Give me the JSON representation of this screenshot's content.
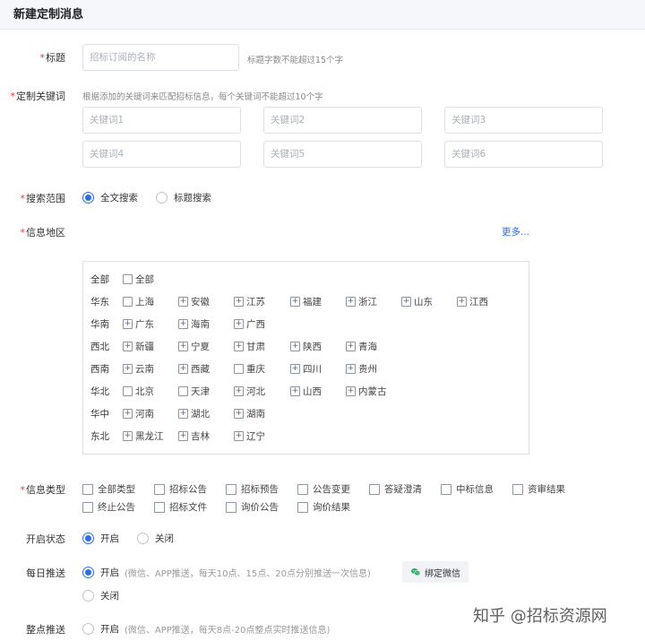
{
  "header": {
    "title": "新建定制消息"
  },
  "title_field": {
    "label": "标题",
    "placeholder": "招标订阅的名称",
    "hint": "标题字数不能超过15个字"
  },
  "keywords": {
    "label": "定制关键词",
    "hint": "根据添加的关键词来匹配招标信息，每个关键词不能超过10个字",
    "placeholders": [
      "关键词1",
      "关键词2",
      "关键词3",
      "关键词4",
      "关键词5",
      "关键词6"
    ]
  },
  "search_scope": {
    "label": "搜索范围",
    "options": [
      "全文搜索",
      "标题搜索"
    ],
    "selected": "全文搜索"
  },
  "region": {
    "label": "信息地区",
    "more": "更多...",
    "groups": [
      {
        "name": "全部",
        "items": [
          {
            "name": "全部",
            "expandable": false
          }
        ]
      },
      {
        "name": "华东",
        "items": [
          {
            "name": "上海",
            "expandable": false
          },
          {
            "name": "安徽",
            "expandable": true
          },
          {
            "name": "江苏",
            "expandable": true
          },
          {
            "name": "福建",
            "expandable": true
          },
          {
            "name": "浙江",
            "expandable": true
          },
          {
            "name": "山东",
            "expandable": true
          },
          {
            "name": "江西",
            "expandable": true
          }
        ]
      },
      {
        "name": "华南",
        "items": [
          {
            "name": "广东",
            "expandable": true
          },
          {
            "name": "海南",
            "expandable": true
          },
          {
            "name": "广西",
            "expandable": true
          }
        ]
      },
      {
        "name": "西北",
        "items": [
          {
            "name": "新疆",
            "expandable": true
          },
          {
            "name": "宁夏",
            "expandable": true
          },
          {
            "name": "甘肃",
            "expandable": true
          },
          {
            "name": "陕西",
            "expandable": true
          },
          {
            "name": "青海",
            "expandable": true
          }
        ]
      },
      {
        "name": "西南",
        "items": [
          {
            "name": "云南",
            "expandable": true
          },
          {
            "name": "西藏",
            "expandable": true
          },
          {
            "name": "重庆",
            "expandable": false
          },
          {
            "name": "四川",
            "expandable": true
          },
          {
            "name": "贵州",
            "expandable": true
          }
        ]
      },
      {
        "name": "华北",
        "items": [
          {
            "name": "北京",
            "expandable": false
          },
          {
            "name": "天津",
            "expandable": false
          },
          {
            "name": "河北",
            "expandable": true
          },
          {
            "name": "山西",
            "expandable": true
          },
          {
            "name": "内蒙古",
            "expandable": true
          }
        ]
      },
      {
        "name": "华中",
        "items": [
          {
            "name": "河南",
            "expandable": true
          },
          {
            "name": "湖北",
            "expandable": true
          },
          {
            "name": "湖南",
            "expandable": true
          }
        ]
      },
      {
        "name": "东北",
        "items": [
          {
            "name": "黑龙江",
            "expandable": true
          },
          {
            "name": "吉林",
            "expandable": true
          },
          {
            "name": "辽宁",
            "expandable": true
          }
        ]
      }
    ]
  },
  "info_type": {
    "label": "信息类型",
    "rows": [
      [
        "全部类型",
        "招标公告",
        "招标预告",
        "公告变更",
        "答疑澄清",
        "中标信息",
        "资审结果"
      ],
      [
        "终止公告",
        "招标文件",
        "询价公告",
        "询价结果"
      ]
    ]
  },
  "open_status": {
    "label": "开启状态",
    "options": [
      "开启",
      "关闭"
    ],
    "selected": "开启"
  },
  "daily_push": {
    "label": "每日推送",
    "on_label": "开启",
    "on_detail": "(微信、APP推送，每天10点、15点、20点分别推送一次信息)",
    "off_label": "关闭",
    "selected": "开启",
    "bind_wechat": "绑定微信"
  },
  "hourly_push": {
    "label": "整点推送",
    "on_label": "开启",
    "on_detail": "(微信、APP推送，每天8点-20点整点实时推送信息)"
  },
  "watermark": "知乎 @招标资源网",
  "colors": {
    "accent": "#2d6fe0",
    "required": "#e23c3c",
    "wechat": "#2aae67"
  },
  "icons": {
    "expand": "plus-square-icon",
    "wechat": "wechat-icon"
  }
}
